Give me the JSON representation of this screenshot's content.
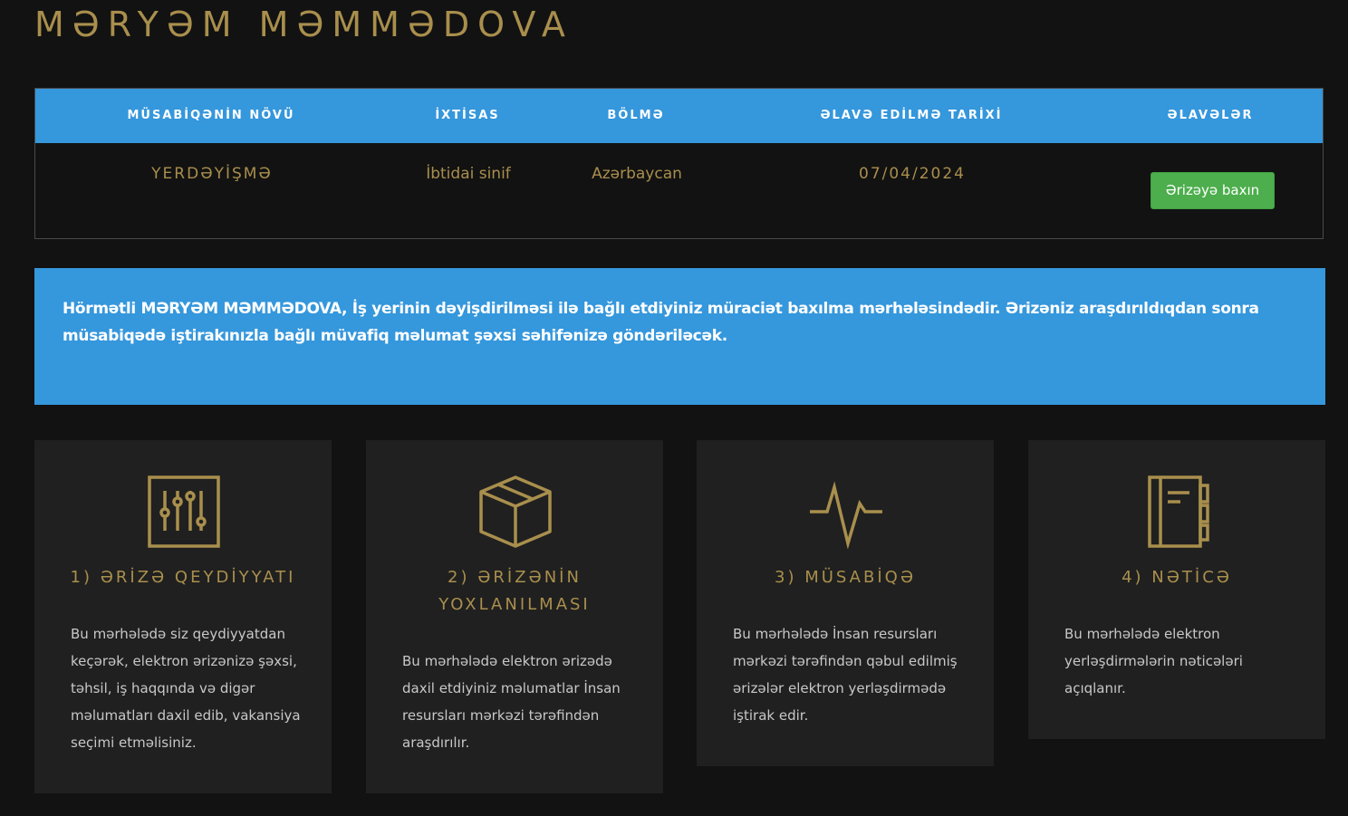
{
  "page": {
    "title": "MƏRYƏM MƏMMƏDOVA"
  },
  "table": {
    "headers": [
      "MÜSABİQƏNİN NÖVÜ",
      "İXTİSAS",
      "BÖLMƏ",
      "ƏLAVƏ EDİLMƏ TARİXİ",
      "ƏLAVƏLƏR"
    ],
    "row": {
      "type": "YERDƏYİŞMƏ",
      "specialty": "İbtidai sinif",
      "section": "Azərbaycan",
      "date": "07/04/2024",
      "button_label": "Ərizəyə baxın"
    }
  },
  "notice": {
    "text": "Hörmətli MƏRYƏM MƏMMƏDOVA, İş yerinin dəyişdirilməsi ilə bağlı etdiyiniz müraciət baxılma mərhələsindədir. Ərizəniz araşdırıldıqdan sonra müsabiqədə iştirakınızla bağlı müvafiq məlumat şəxsi səhifənizə göndəriləcək."
  },
  "steps": [
    {
      "icon": "sliders-icon",
      "title": "1) ƏRİZƏ QEYDİYYATI",
      "description": "Bu mərhələdə siz qeydiyyatdan keçərək, elektron ərizənizə şəxsi, təhsil, iş haqqında və digər məlumatları daxil edib, vakansiya seçimi etməlisiniz."
    },
    {
      "icon": "box-icon",
      "title": "2) ƏRİZƏNİN YOXLANILMASI",
      "description": "Bu mərhələdə elektron ərizədə daxil etdiyiniz məlumatlar İnsan resursları mərkəzi tərəfindən araşdırılır."
    },
    {
      "icon": "pulse-icon",
      "title": "3) MÜSABİQƏ",
      "description": "Bu mərhələdə İnsan resursları mərkəzi tərəfindən qəbul edilmiş ərizələr elektron yerləşdirmədə iştirak edir."
    },
    {
      "icon": "notebook-icon",
      "title": "4) NƏTİCƏ",
      "description": "Bu mərhələdə elektron yerləşdirmələrin nəticələri açıqlanır."
    }
  ],
  "colors": {
    "accent": "#a98f4d",
    "primary": "#3597dc",
    "success": "#4cae4c",
    "background": "#121212",
    "card": "#202020"
  }
}
